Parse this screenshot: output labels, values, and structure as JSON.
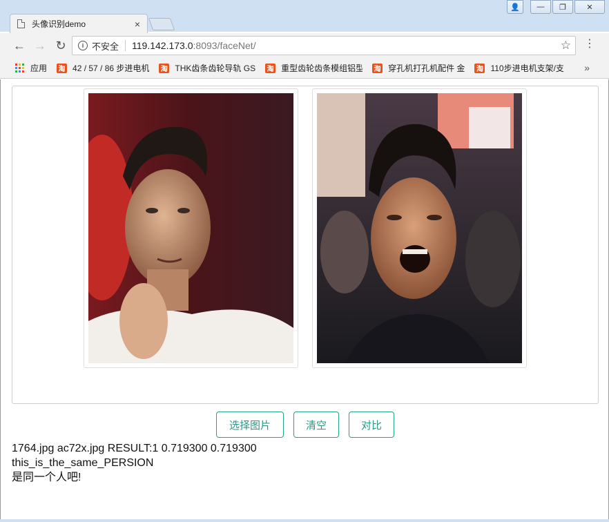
{
  "browser": {
    "tab_title": "头像识别demo",
    "tab_close": "×",
    "security_label": "不安全",
    "url_host": "119.142.173.0",
    "url_path": ":8093/faceNet/",
    "back_glyph": "←",
    "forward_glyph": "→",
    "reload_glyph": "↻",
    "star_glyph": "☆",
    "menu_glyph": "⋮"
  },
  "window_controls": {
    "user": "👤",
    "minimize": "—",
    "restore": "❐",
    "close": "✕"
  },
  "bookmarks": {
    "apps_label": "应用",
    "items": [
      {
        "label": "42 / 57 / 86 步进电机",
        "icon": "taobao-icon"
      },
      {
        "label": "THK齿条齿轮导轨 GS",
        "icon": "taobao-icon"
      },
      {
        "label": "重型齿轮齿条模组铝型",
        "icon": "taobao-icon"
      },
      {
        "label": "穿孔机打孔机配件 金",
        "icon": "taobao-icon"
      },
      {
        "label": "110步进电机支架/支",
        "icon": "taobao-icon"
      }
    ],
    "more": "»",
    "icon_glyph": "淘"
  },
  "images": {
    "left": {
      "icon": "portrait-photo",
      "description_hidden": ""
    },
    "right": {
      "icon": "laughing-portrait-photo",
      "description_hidden": ""
    }
  },
  "buttons": {
    "choose": "选择图片",
    "clear": "清空",
    "compare": "对比"
  },
  "result": {
    "line1": "1764.jpg ac72x.jpg RESULT:1 0.719300 0.719300",
    "line2": "this_is_the_same_PERSION",
    "line3": "是同一个人吧!"
  },
  "colors": {
    "accent": "#259a85",
    "chrome": "#cfe0f3",
    "taobao": "#e8541e"
  }
}
